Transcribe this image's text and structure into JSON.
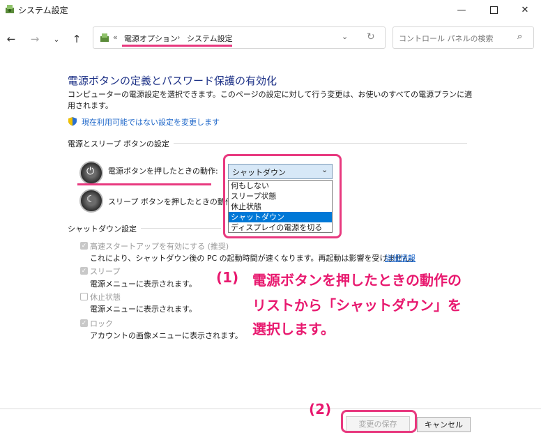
{
  "window": {
    "title": "システム設定",
    "icons": [
      "app-icon",
      "minimize-icon",
      "maximize-icon",
      "close-icon"
    ]
  },
  "nav": {
    "breadcrumb_prefix": "«",
    "crumb1": "電源オプション",
    "sep": "›",
    "crumb2": "システム設定",
    "search_placeholder": "コントロール パネルの検索"
  },
  "content": {
    "title": "電源ボタンの定義とパスワード保護の有効化",
    "description": "コンピューターの電源設定を選択できます。このページの設定に対して行う変更は、お使いのすべての電源プランに適用されます。",
    "admin_link": "現在利用可能ではない設定を変更します",
    "section_power": "電源とスリープ ボタンの設定",
    "power_button_label": "電源ボタンを押したときの動作:",
    "sleep_button_label": "スリープ ボタンを押したときの動作:",
    "dropdown": {
      "selected": "シャットダウン",
      "options": [
        "何もしない",
        "スリープ状態",
        "休止状態",
        "シャットダウン",
        "ディスプレイの電源を切る"
      ],
      "highlighted_index": 3
    },
    "section_shutdown": "シャットダウン設定",
    "fast_startup": {
      "label": "高速スタートアップを有効にする (推奨)",
      "desc": "これにより、シャットダウン後の PC の起動時間が速くなります。再起動は影響を受けません。",
      "link": "詳細情報",
      "checked": true
    },
    "sleep": {
      "label": "スリープ",
      "desc": "電源メニューに表示されます。",
      "checked": true
    },
    "hibernate": {
      "label": "休止状態",
      "desc": "電源メニューに表示されます。",
      "checked": false
    },
    "lock": {
      "label": "ロック",
      "desc": "アカウントの画像メニューに表示されます。",
      "checked": true
    }
  },
  "annotation": {
    "step1_num": "(1)",
    "step1_line1": "電源ボタンを押したときの動作の",
    "step1_line2": "リストから「シャットダウン」を",
    "step1_line3": "選択します。",
    "step2_num": "(2)",
    "color": "#e8196f"
  },
  "buttons": {
    "save": "変更の保存",
    "cancel": "キャンセル"
  }
}
